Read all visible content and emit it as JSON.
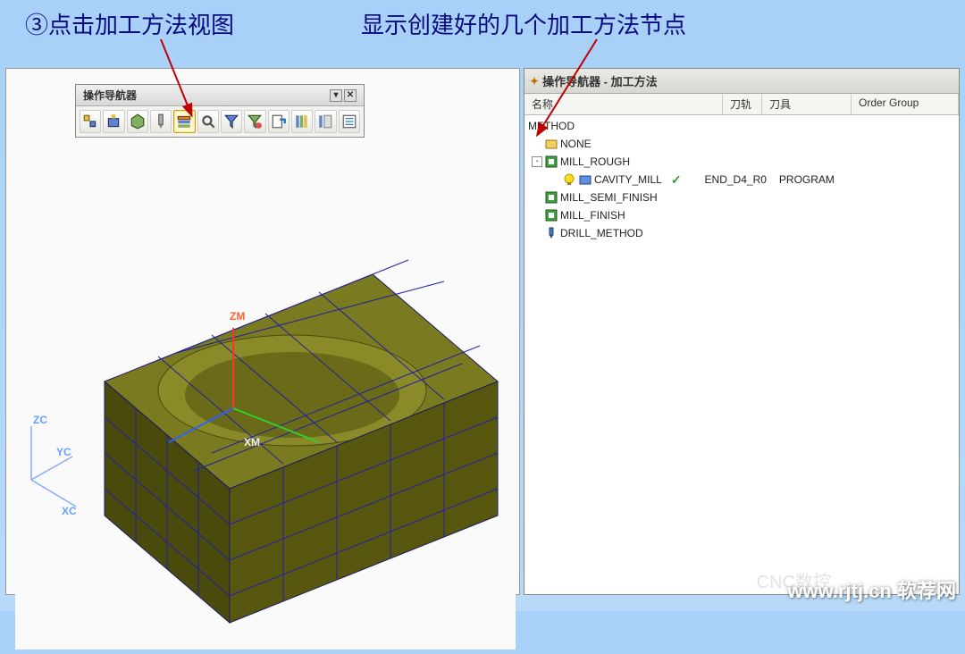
{
  "annotations": {
    "left": "③点击加工方法视图",
    "right": "显示创建好的几个加工方法节点"
  },
  "toolbar": {
    "title": "操作导航器",
    "dropdown_symbol": "▾",
    "close_symbol": "✕",
    "buttons": [
      {
        "name": "program-order-view"
      },
      {
        "name": "machine-view"
      },
      {
        "name": "geometry-view"
      },
      {
        "name": "tool-view"
      },
      {
        "name": "method-view",
        "highlight": true
      },
      {
        "name": "find-object"
      },
      {
        "name": "create-filter"
      },
      {
        "name": "apply-filter"
      },
      {
        "name": "export-list"
      },
      {
        "name": "columns"
      },
      {
        "name": "freeze-columns"
      },
      {
        "name": "properties"
      }
    ]
  },
  "model": {
    "axes_global": {
      "zc": "ZC",
      "yc": "YC",
      "xc": "XC"
    },
    "axes_wcs": {
      "zm": "ZM",
      "xm": "XM"
    }
  },
  "navigator": {
    "title_prefix_icon": "📌",
    "title": "操作导航器 - 加工方法",
    "columns": {
      "name": "名称",
      "track": "刀轨",
      "tool": "刀具",
      "order": "Order Group"
    },
    "root": "METHOD",
    "items": [
      {
        "label": "NONE",
        "icon": "none",
        "indent": 1
      },
      {
        "label": "MILL_ROUGH",
        "icon": "mill",
        "indent": 1,
        "expanded": true
      },
      {
        "label": "CAVITY_MILL",
        "icon": "cavity",
        "indent": 2,
        "checked": true,
        "tool": "END_D4_R0",
        "order": "PROGRAM"
      },
      {
        "label": "MILL_SEMI_FINISH",
        "icon": "mill",
        "indent": 1
      },
      {
        "label": "MILL_FINISH",
        "icon": "mill",
        "indent": 1
      },
      {
        "label": "DRILL_METHOD",
        "icon": "drill",
        "indent": 1
      }
    ]
  },
  "watermark": "www.rjtj.cn 软荐网",
  "watermark_faint": "CNC数控"
}
